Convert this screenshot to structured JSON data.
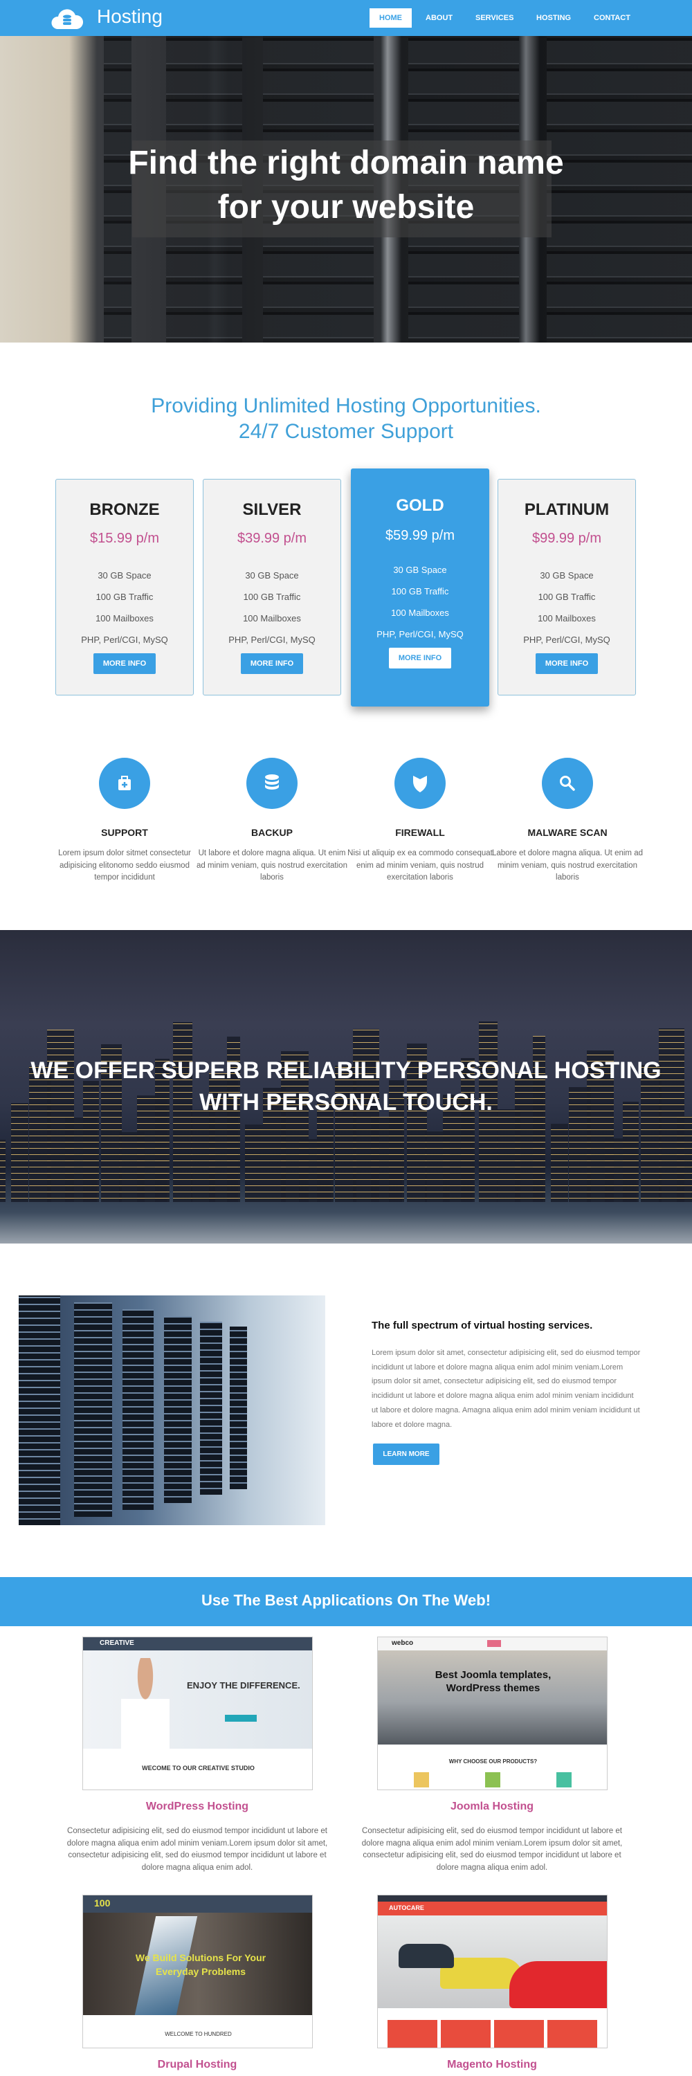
{
  "nav": {
    "brand": "Hosting",
    "items": [
      {
        "label": "HOME",
        "active": true
      },
      {
        "label": "ABOUT"
      },
      {
        "label": "SERVICES"
      },
      {
        "label": "HOSTING"
      },
      {
        "label": "CONTACT"
      }
    ]
  },
  "hero": {
    "title": "Find the right domain name for your website",
    "slides": 3,
    "active_slide": 1
  },
  "pricing": {
    "headline_1": "Providing Unlimited Hosting Opportunities.",
    "headline_2": "24/7 Customer Support",
    "plans": [
      {
        "name": "BRONZE",
        "price": "$15.99 p/m",
        "features": [
          "30 GB Space",
          "100 GB Traffic",
          "100 Mailboxes",
          "PHP, Perl/CGI, MySQ"
        ],
        "button": "MORE INFO"
      },
      {
        "name": "SILVER",
        "price": "$39.99 p/m",
        "features": [
          "30 GB Space",
          "100 GB Traffic",
          "100 Mailboxes",
          "PHP, Perl/CGI, MySQ"
        ],
        "button": "MORE INFO"
      },
      {
        "name": "GOLD",
        "price": "$59.99 p/m",
        "features": [
          "30 GB Space",
          "100 GB Traffic",
          "100 Mailboxes",
          "PHP, Perl/CGI, MySQ"
        ],
        "button": "MORE INFO",
        "highlighted": true
      },
      {
        "name": "PLATINUM",
        "price": "$99.99 p/m",
        "features": [
          "30 GB Space",
          "100 GB Traffic",
          "100 Mailboxes",
          "PHP, Perl/CGI, MySQ"
        ],
        "button": "MORE INFO"
      }
    ]
  },
  "features": [
    {
      "icon": "medkit-icon",
      "title": "SUPPORT",
      "text": "Lorem ipsum dolor sitmet consectetur adipisicing elitonomo seddo eiusmod tempor incididunt"
    },
    {
      "icon": "database-icon",
      "title": "BACKUP",
      "text": "Ut labore et dolore magna aliqua. Ut enim ad minim veniam, quis nostrud exercitation laboris"
    },
    {
      "icon": "shield-icon",
      "title": "FIREWALL",
      "text": "Nisi ut aliquip ex ea commodo consequat enim ad minim veniam, quis nostrud exercitation laboris"
    },
    {
      "icon": "search-icon",
      "title": "MALWARE SCAN",
      "text": "Labore et dolore magna aliqua. Ut enim ad minim veniam, quis nostrud exercitation laboris"
    }
  ],
  "banner": {
    "title": "WE OFFER SUPERB RELIABILITY PERSONAL HOSTING WITH PERSONAL TOUCH."
  },
  "about": {
    "heading": "The full spectrum of virtual hosting services.",
    "text": "Lorem ipsum dolor sit amet, consectetur adipisicing elit, sed do eiusmod tempor incididunt ut labore et dolore magna aliqua enim adol minim veniam.Lorem ipsum dolor sit amet, consectetur adipisicing elit, sed do eiusmod tempor incididunt ut labore et dolore magna aliqua enim adol minim veniam incididunt ut labore et dolore magna. Amagna aliqua enim adol minim veniam incididunt ut labore et dolore magna.",
    "button": "LEARN MORE"
  },
  "apps": {
    "title": "Use The Best Applications On The Web!",
    "items": [
      {
        "title": "WordPress Hosting",
        "text": "Consectetur adipisicing elit, sed do eiusmod tempor incididunt ut labore et dolore magna aliqua enim adol minim veniam.Lorem ipsum dolor sit amet, consectetur adipisicing elit, sed do eiusmod tempor incididunt ut labore et dolore magna aliqua enim adol.",
        "thumb": {
          "brand": "CREATIVE",
          "headline": "ENJOY THE DIFFERENCE.",
          "footer": "WECOME TO OUR CREATIVE STUDIO"
        }
      },
      {
        "title": "Joomla Hosting",
        "text": "Consectetur adipisicing elit, sed do eiusmod tempor incididunt ut labore et dolore magna aliqua enim adol minim veniam.Lorem ipsum dolor sit amet, consectetur adipisicing elit, sed do eiusmod tempor incididunt ut labore et dolore magna aliqua enim adol.",
        "thumb": {
          "brand": "webco",
          "headline": "Best Joomla templates, WordPress themes",
          "footer": "WHY CHOOSE OUR PRODUCTS?"
        }
      },
      {
        "title": "Drupal Hosting",
        "thumb": {
          "brand": "100",
          "headline": "We Build Solutions For Your Everyday Problems",
          "footer": "WELCOME TO HUNDRED"
        }
      },
      {
        "title": "Magento Hosting",
        "thumb": {
          "brand": "AUTOCARE"
        }
      }
    ]
  },
  "colors": {
    "accent": "#3aa2e6",
    "price": "#c2508f",
    "heading": "#3fa0d8"
  }
}
